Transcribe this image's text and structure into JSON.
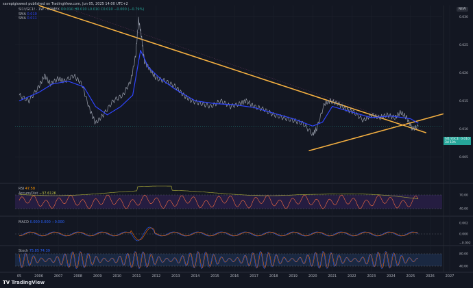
{
  "header": {
    "published": "savepigiowest published on TradingView.com, Jun 05, 2025 14:00 UTC+2",
    "symbol_line": "SI1!/GC1! · 1W · COMEX",
    "ohlc": "O0.010 H0.010 L0.010 C0.010 −0.000 (−0.79%)",
    "sma1_label": "SMA",
    "sma1_value": "0.010",
    "sma2_label": "SMA",
    "sma2_value": "0.011"
  },
  "top_right_button": "NEW",
  "price_tag": {
    "symbol": "SI1!/GC1!",
    "value": "0.010",
    "time": "3d 10h"
  },
  "logo_text": "TradingView",
  "colors": {
    "background": "#131722",
    "price": "#9aa0ad",
    "sma": "#2f45ff",
    "trend": "#f5b041",
    "rsi_band": "#2a1f4a",
    "stoch_band": "#1c2a45"
  },
  "panels": {
    "rsi": {
      "label": "RSI",
      "value": "47.58",
      "sub_label": "Accum/Dist",
      "sub_value": "−37.6126"
    },
    "macd": {
      "label": "MACD",
      "values": "0.000  0.000  −0.000"
    },
    "stoch": {
      "label": "Stoch",
      "values": "75.85  74.39"
    }
  },
  "chart_data": {
    "type": "line",
    "title": "",
    "xlabel": "",
    "ylabel": "",
    "x_ticks": [
      "05",
      "2006",
      "2007",
      "2008",
      "2009",
      "2010",
      "2011",
      "2012",
      "2013",
      "2014",
      "2015",
      "2016",
      "2017",
      "2018",
      "2019",
      "2020",
      "2021",
      "2022",
      "2023",
      "2024",
      "2025",
      "2026",
      "2027"
    ],
    "price_y_ticks": [
      "0.030",
      "0.025",
      "0.020",
      "0.015",
      "0.010",
      "0.005"
    ],
    "ylim": [
      0.001,
      0.032
    ],
    "series": [
      {
        "key": "price",
        "x": [
          2005.0,
          2005.5,
          2006.0,
          2006.3,
          2006.6,
          2007.0,
          2007.3,
          2007.8,
          2008.2,
          2008.6,
          2008.9,
          2009.3,
          2009.8,
          2010.3,
          2010.7,
          2010.95,
          2011.1,
          2011.25,
          2011.4,
          2011.7,
          2012.0,
          2012.5,
          2013.0,
          2013.4,
          2013.8,
          2014.3,
          2014.8,
          2015.3,
          2015.8,
          2016.3,
          2016.6,
          2017.0,
          2017.5,
          2018.0,
          2018.5,
          2019.0,
          2019.5,
          2020.0,
          2020.2,
          2020.6,
          2020.9,
          2021.3,
          2021.7,
          2022.1,
          2022.6,
          2023.0,
          2023.4,
          2023.8,
          2024.2,
          2024.5,
          2024.8,
          2025.1,
          2025.4
        ],
        "values": [
          0.016,
          0.015,
          0.0175,
          0.0195,
          0.018,
          0.019,
          0.0185,
          0.0195,
          0.018,
          0.0135,
          0.011,
          0.0125,
          0.015,
          0.016,
          0.0185,
          0.023,
          0.0295,
          0.0265,
          0.022,
          0.0205,
          0.019,
          0.0185,
          0.0175,
          0.016,
          0.015,
          0.0145,
          0.014,
          0.015,
          0.014,
          0.0145,
          0.015,
          0.014,
          0.0135,
          0.0125,
          0.012,
          0.0115,
          0.011,
          0.009,
          0.01,
          0.0145,
          0.015,
          0.0145,
          0.0135,
          0.013,
          0.0115,
          0.0125,
          0.012,
          0.0125,
          0.012,
          0.013,
          0.012,
          0.01,
          0.0105
        ]
      },
      {
        "key": "sma",
        "x": [
          2005.0,
          2006.0,
          2006.7,
          2007.5,
          2008.3,
          2008.9,
          2009.5,
          2010.2,
          2010.8,
          2011.2,
          2011.6,
          2012.2,
          2013.0,
          2014.0,
          2015.0,
          2016.0,
          2017.0,
          2018.0,
          2019.0,
          2020.0,
          2020.5,
          2021.0,
          2022.0,
          2023.0,
          2024.0,
          2025.0,
          2025.4
        ],
        "values": [
          0.015,
          0.0165,
          0.018,
          0.0185,
          0.0175,
          0.014,
          0.0125,
          0.014,
          0.016,
          0.024,
          0.021,
          0.019,
          0.017,
          0.015,
          0.0145,
          0.0143,
          0.0138,
          0.0128,
          0.0118,
          0.0105,
          0.0112,
          0.014,
          0.013,
          0.012,
          0.0123,
          0.0118,
          0.011
        ]
      }
    ],
    "trendlines": [
      {
        "name": "",
        "x": [
          2006.0,
          2025.8
        ],
        "values": [
          0.032,
          0.0093
        ]
      },
      {
        "name": "",
        "x": [
          2019.8,
          2026.7
        ],
        "values": [
          0.0061,
          0.0127
        ]
      }
    ],
    "indicator_levels": {
      "rsi": [
        "70.00",
        "40.00"
      ],
      "macd": [
        "0.002",
        "0.000",
        "−0.002"
      ],
      "stoch": [
        "80.00",
        "40.00"
      ]
    },
    "grid": true,
    "legend": "top-left"
  }
}
